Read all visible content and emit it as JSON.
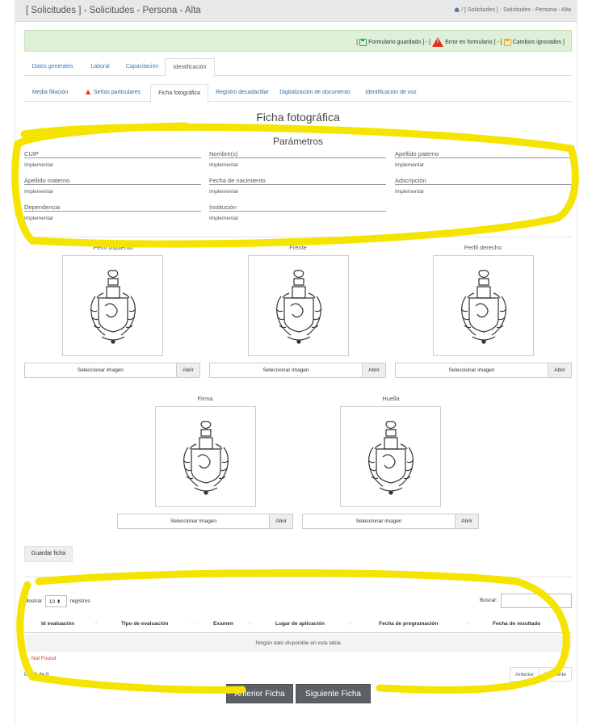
{
  "header": {
    "title": "[ Solicitudes ] - Solicitudes - Persona - Alta",
    "breadcrumb": "/ [ Solicitudes ] - Solicitudes - Persona - Alta"
  },
  "alert": {
    "saved": "Formulario guardado",
    "error": "Error en formulario",
    "ignored": "Cambios ignorados",
    "open_bracket": "[",
    "sep1": "] - [",
    "sep2": "] - [",
    "close_bracket": "]"
  },
  "tabs_main": [
    "Datos generales",
    "Laboral",
    "Capacitación",
    "Identificación"
  ],
  "tabs_sub": [
    "Media filiación",
    "Señas particulares",
    "Ficha fotográfica",
    "Registro decadactilar",
    "Digitalización de documento",
    "Identificación de voz"
  ],
  "section_title": "Ficha fotográfica",
  "params_title": "Parámetros",
  "params": [
    {
      "label": "CUIP",
      "value": "Implementar"
    },
    {
      "label": "Nombre(s)",
      "value": "Implementar"
    },
    {
      "label": "Apellido paterno",
      "value": "Implementar"
    },
    {
      "label": "Apellido materno",
      "value": "Implementar"
    },
    {
      "label": "Fecha de nacimiento",
      "value": "Implementar"
    },
    {
      "label": "Adscripción",
      "value": "Implementar"
    },
    {
      "label": "Dependencia",
      "value": "Implementar"
    },
    {
      "label": "Institución",
      "value": "Implementar"
    }
  ],
  "photos": [
    "Perfil izquierdo",
    "Frente",
    "Perfil derecho",
    "Firma",
    "Huella"
  ],
  "picker": {
    "select_label": "Seleccionar imagen",
    "open_label": "Abrir"
  },
  "save_label": "Guardar ficha",
  "table": {
    "show": "Mostrar",
    "length": "10",
    "records": "registros",
    "search": "Buscar:",
    "columns": [
      "Id evaluación",
      "Tipo de evaluación",
      "Examen",
      "Lugar de aplicación",
      "Fecha de programación",
      "Fecha de resultado"
    ],
    "empty": "Ningún dato disponible en esta tabla",
    "not_found": "Not Found",
    "info": "0 al 0 de 0",
    "prev": "Anterior",
    "next": "Siguiente"
  },
  "nav": {
    "prev": "Anterior Ficha",
    "next": "Siguiente Ficha"
  },
  "colors": {
    "highlight": "#f5e400",
    "alert_bg": "#dff0d8",
    "link": "#3a7bbf",
    "danger": "#e0301e"
  }
}
